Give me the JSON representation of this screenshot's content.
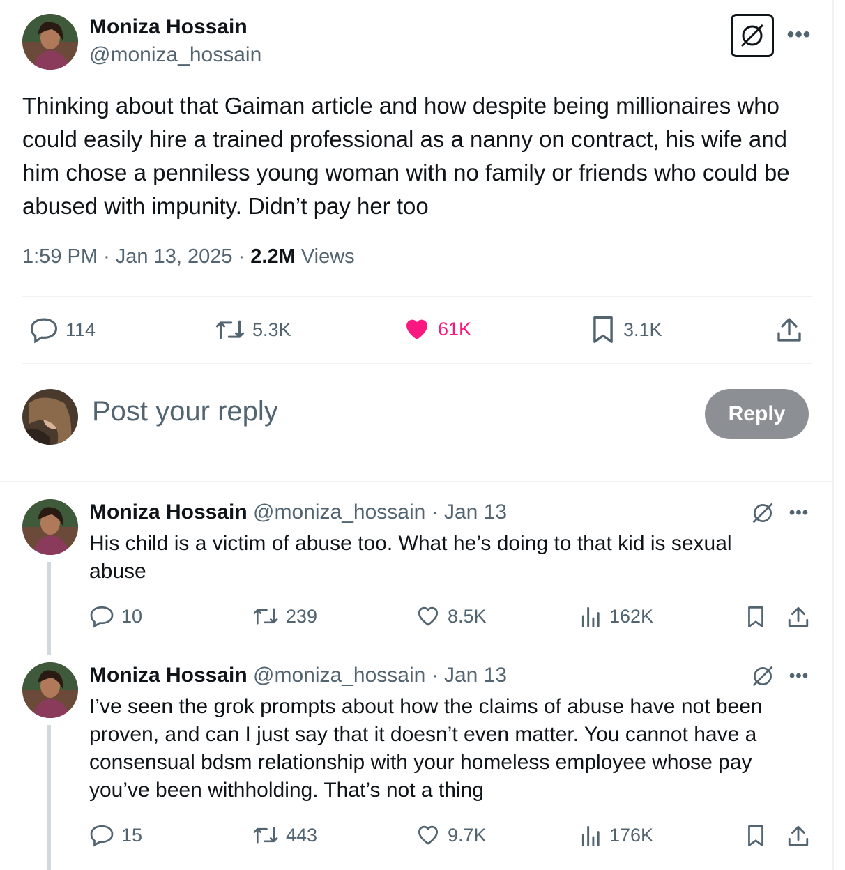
{
  "main_post": {
    "author_name": "Moniza Hossain",
    "author_handle": "@moniza_hossain",
    "text": "Thinking about that Gaiman article and how despite being millionaires who could easily hire a trained professional as a nanny on contract, his wife and him chose a penniless young woman with no family or friends who could be abused with impunity. Didn’t pay her too",
    "time": "1:59 PM",
    "date": "Jan 13, 2025",
    "views_count": "2.2M",
    "views_label": "Views",
    "replies": "114",
    "reposts": "5.3K",
    "likes": "61K",
    "bookmarks": "3.1K"
  },
  "composer": {
    "placeholder": "Post your reply",
    "button_label": "Reply"
  },
  "replies": [
    {
      "author_name": "Moniza Hossain",
      "author_handle": "@moniza_hossain",
      "date": "· Jan 13",
      "text": "His child is a victim of abuse too. What he’s doing to that kid is sexual abuse",
      "replies": "10",
      "reposts": "239",
      "likes": "8.5K",
      "views": "162K"
    },
    {
      "author_name": "Moniza Hossain",
      "author_handle": "@moniza_hossain",
      "date": "· Jan 13",
      "text": "I’ve seen the grok prompts about how the claims of abuse have not been proven, and can I just say that it doesn’t even matter. You cannot have a consensual bdsm relationship with your homeless employee whose pay you’ve been withholding. That’s not a thing",
      "replies": "15",
      "reposts": "443",
      "likes": "9.7K",
      "views": "176K"
    }
  ],
  "icons": {
    "more": "more-icon",
    "grok": "grok-icon",
    "reply": "reply-icon",
    "repost": "repost-icon",
    "like": "heart-icon",
    "bookmark": "bookmark-icon",
    "share": "share-icon",
    "views": "views-icon"
  },
  "colors": {
    "liked": "#f91880",
    "secondary_text": "#536471",
    "reply_button": "#8c9094"
  }
}
